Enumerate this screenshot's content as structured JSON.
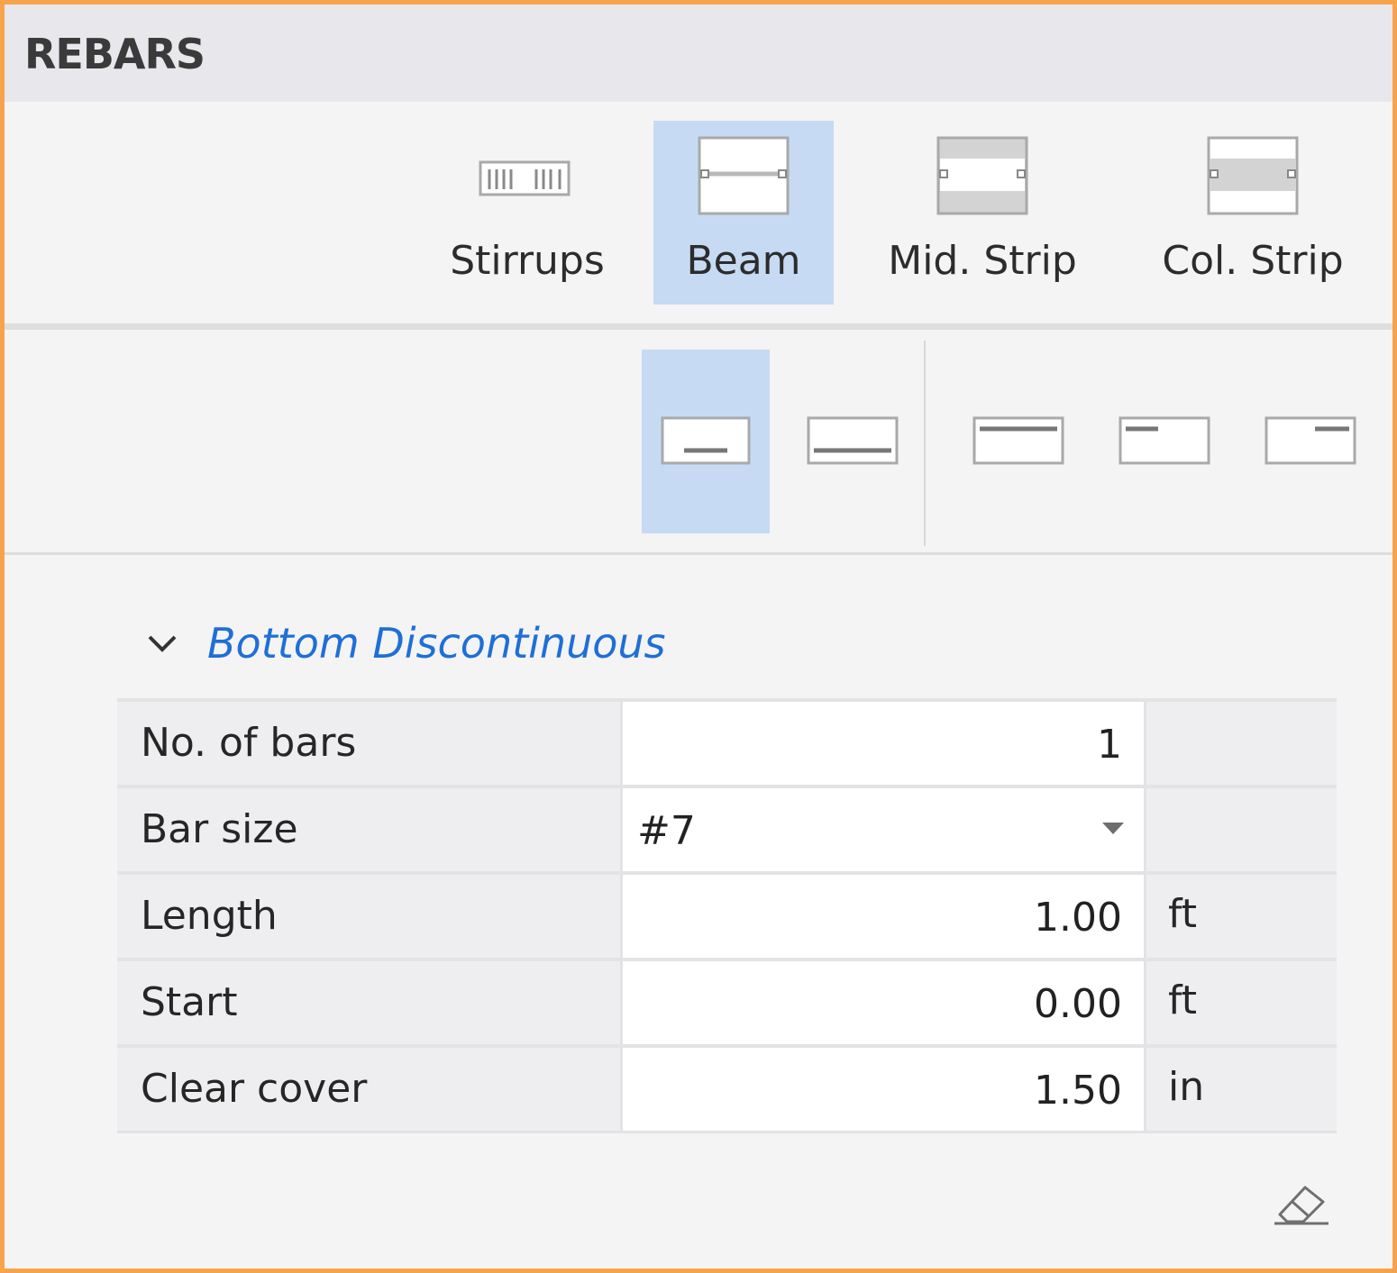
{
  "header": {
    "title": "REBARS"
  },
  "type_tabs": [
    {
      "label": "Stirrups",
      "icon": "stirrups-icon",
      "selected": false
    },
    {
      "label": "Beam",
      "icon": "beam-icon",
      "selected": true
    },
    {
      "label": "Mid. Strip",
      "icon": "mid-strip-icon",
      "selected": false
    },
    {
      "label": "Col. Strip",
      "icon": "col-strip-icon",
      "selected": false
    }
  ],
  "position_buttons": [
    {
      "icon": "bottom-discontinuous-icon",
      "selected": true
    },
    {
      "icon": "bottom-continuous-icon",
      "selected": false
    },
    {
      "icon": "top-continuous-icon",
      "selected": false
    },
    {
      "icon": "top-left-icon",
      "selected": false
    },
    {
      "icon": "top-right-icon",
      "selected": false
    }
  ],
  "section": {
    "title": "Bottom Discontinuous",
    "expanded": true
  },
  "properties": [
    {
      "label": "No. of bars",
      "value": "1",
      "unit": ""
    },
    {
      "label": "Bar size",
      "value": "#7",
      "unit": "",
      "type": "dropdown"
    },
    {
      "label": "Length",
      "value": "1.00",
      "unit": "ft"
    },
    {
      "label": "Start",
      "value": "0.00",
      "unit": "ft"
    },
    {
      "label": "Clear cover",
      "value": "1.50",
      "unit": "in"
    }
  ],
  "actions": {
    "clear_icon": "eraser-icon"
  },
  "colors": {
    "border": "#f6a34b",
    "selected": "#c6dbf3",
    "section_title": "#1f6fd6"
  }
}
